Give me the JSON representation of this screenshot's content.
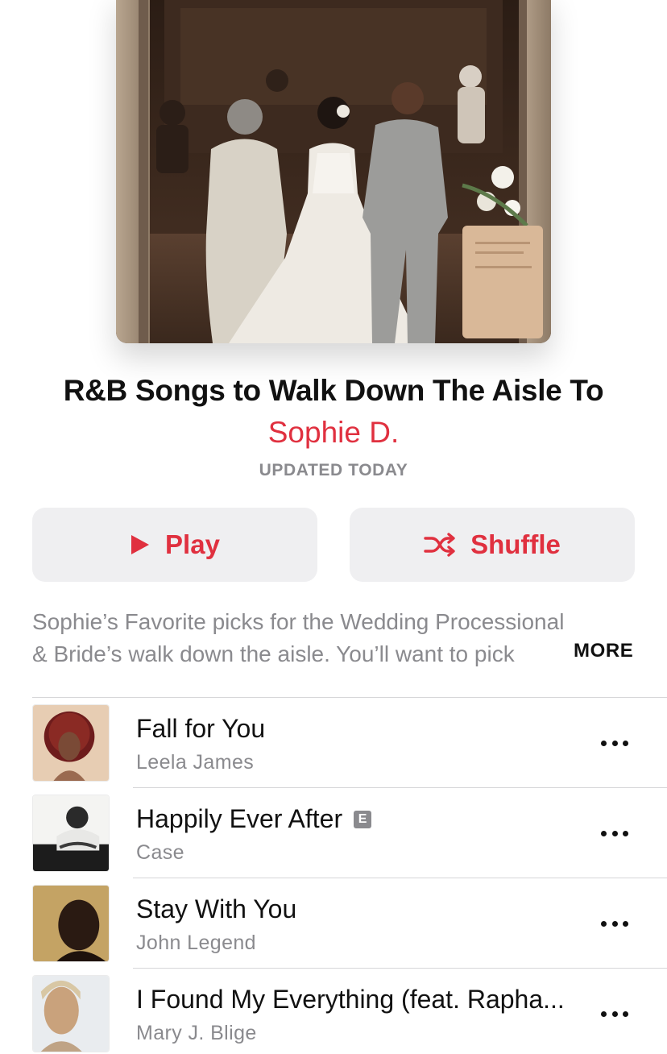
{
  "playlist": {
    "title": "R&B Songs to Walk Down The Aisle To",
    "curator": "Sophie  D.",
    "updated": "UPDATED TODAY",
    "description_line1": "Sophie’s Favorite picks for the Wedding Processional",
    "description_line2": "& Bride’s walk down the aisle. You’ll want to pick",
    "more_label": "MORE"
  },
  "actions": {
    "play_label": "Play",
    "shuffle_label": "Shuffle"
  },
  "tracks": [
    {
      "title": "Fall for You",
      "artist": "Leela James",
      "explicit": false
    },
    {
      "title": "Happily Ever After",
      "artist": "Case",
      "explicit": true,
      "explicit_label": "E"
    },
    {
      "title": "Stay With You",
      "artist": "John Legend",
      "explicit": false
    },
    {
      "title": "I Found My Everything (feat. Rapha...",
      "artist": "Mary J. Blige",
      "explicit": false
    }
  ],
  "colors": {
    "accent": "#e0303f",
    "secondary_text": "#8a8a8e",
    "button_bg": "#efeff1"
  },
  "icons": {
    "play": "play-icon",
    "shuffle": "shuffle-icon",
    "more": "ellipsis-icon"
  }
}
